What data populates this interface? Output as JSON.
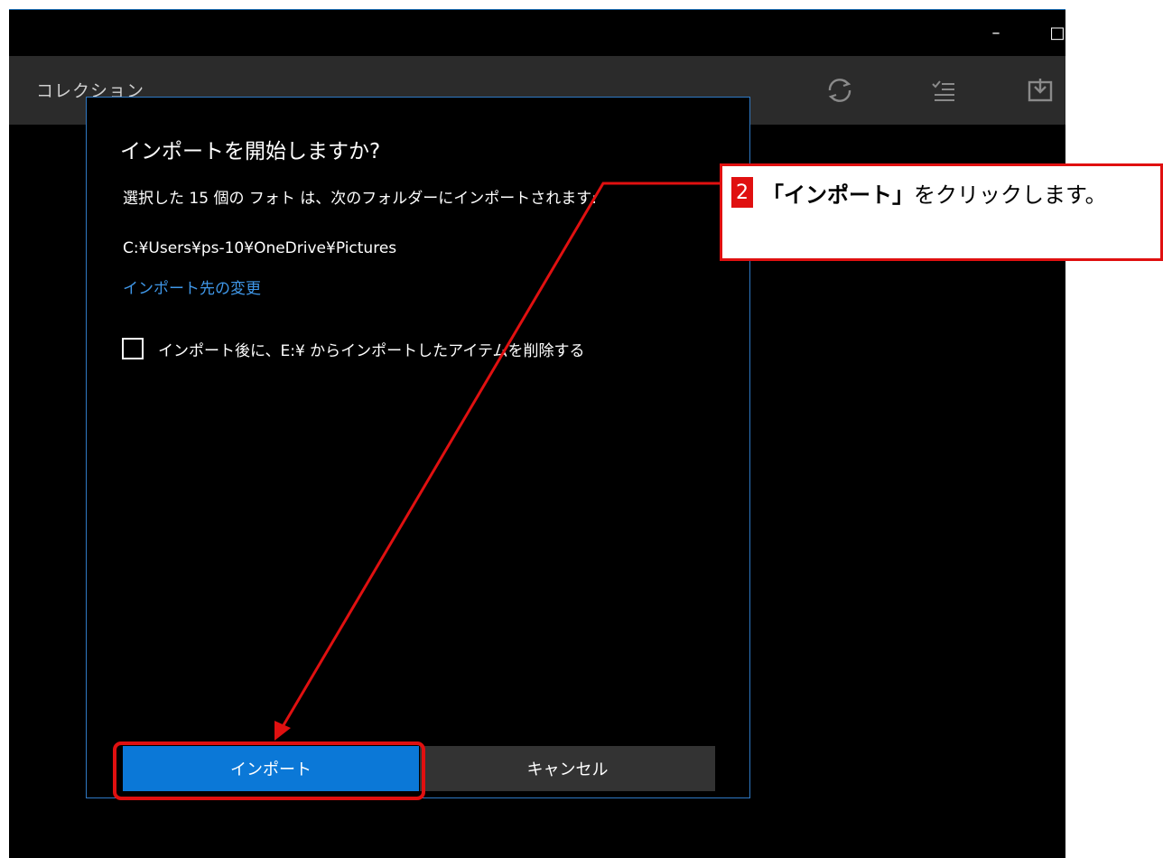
{
  "window": {
    "minimize_glyph": "–",
    "maximize_glyph": "□"
  },
  "toolbar": {
    "title": "コレクション",
    "icons": [
      "refresh-icon",
      "select-list-icon",
      "import-icon"
    ]
  },
  "dialog": {
    "title": "インポートを開始しますか?",
    "message": "選択した 15 個の フォト は、次のフォルダーにインポートされます:",
    "path": "C:¥Users¥ps-10¥OneDrive¥Pictures",
    "change_link": "インポート先の変更",
    "checkbox_label": "インポート後に、E:¥ からインポートしたアイテムを削除する",
    "checkbox_checked": false,
    "import_button": "インポート",
    "cancel_button": "キャンセル"
  },
  "callout": {
    "step_number": "2",
    "quoted_label": "「インポート」",
    "instruction_rest": "をクリックします。"
  },
  "colors": {
    "accent": "#0b78d7",
    "link": "#3f97e8",
    "annotation": "#e01010",
    "dialog_border": "#2f79c4"
  }
}
